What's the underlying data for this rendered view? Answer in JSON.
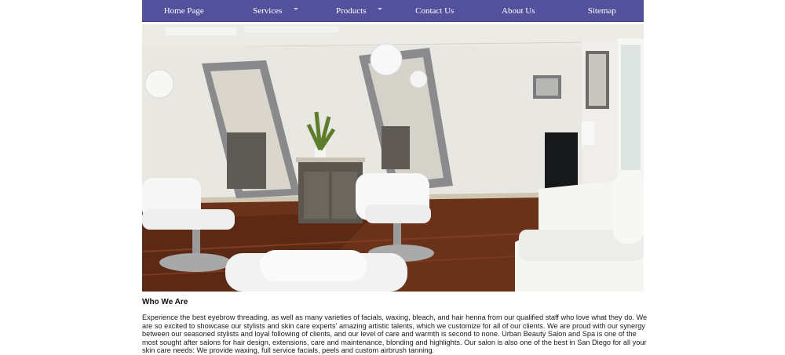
{
  "nav": {
    "items": [
      {
        "label": "Home Page",
        "dropdown": false
      },
      {
        "label": "Services",
        "dropdown": true
      },
      {
        "label": "Products",
        "dropdown": true
      },
      {
        "label": "Contact Us",
        "dropdown": false
      },
      {
        "label": "About Us",
        "dropdown": false
      },
      {
        "label": "Sitemap",
        "dropdown": false
      }
    ],
    "background": "#53509c"
  },
  "hero": {
    "subject": "salon-interior-photo"
  },
  "about": {
    "heading": "Who We Are",
    "body": "Experience the best eyebrow threading, as well as many varieties of facials, waxing, bleach, and hair henna from our qualified staff who love what they do. We are so excited to showcase our stylists and skin care experts' amazing artistic talents, which we customize for all of our clients. We are proud with our synergy between our seasoned stylists and loyal following of clients, and our level of care and warmth is second to none. Urban Beauty Salon and Spa is one of the most sought after salons for hair design, extensions, care and maintenance, blonding and highlights. Our salon is also one of the best in San Diego for all your skin care needs: We provide waxing, full service facials, peels and custom airbrush tanning."
  }
}
